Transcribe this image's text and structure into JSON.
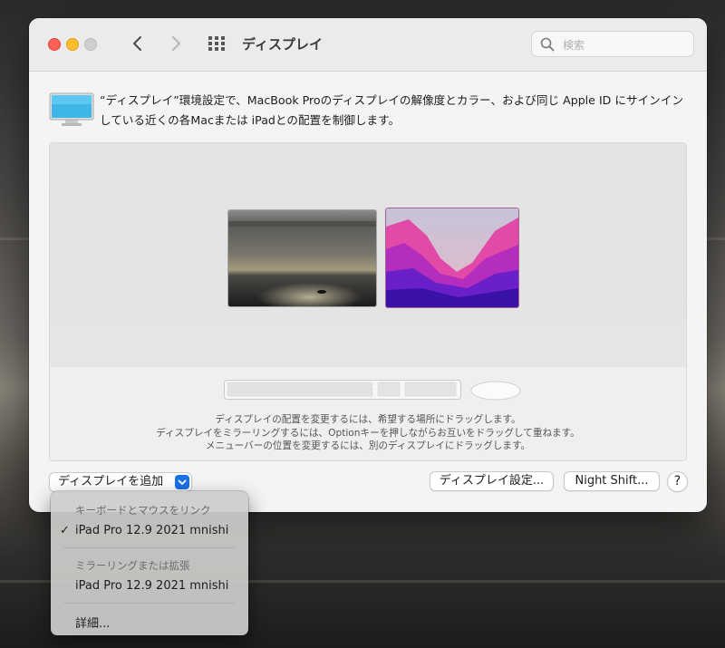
{
  "window": {
    "title": "ディスプレイ",
    "search_placeholder": "検索"
  },
  "description": "“ディスプレイ”環境設定で、MacBook Proのディスプレイの解像度とカラー、および同じ Apple ID にサインインしている近くの各Macまたは iPadとの配置を制御します。",
  "arrangement": {
    "hint_lines": [
      "ディスプレイの配置を変更するには、希望する場所にドラッグします。",
      "ディスプレイをミラーリングするには、Optionキーを押しながらお互いをドラッグして重ねます。",
      "メニューバーの位置を変更するには、別のディスプレイにドラッグします。"
    ]
  },
  "buttons": {
    "add_display": "ディスプレイを追加",
    "display_settings": "ディスプレイ設定...",
    "night_shift": "Night Shift...",
    "help": "?"
  },
  "menu": {
    "section1_header": "キーボードとマウスをリンク",
    "section1_item": "iPad Pro 12.9 2021 mnishi",
    "section1_checked": "✓",
    "section2_header": "ミラーリングまたは拡張",
    "section2_item": "iPad Pro 12.9 2021 mnishi",
    "more": "詳細..."
  },
  "colors": {
    "accent": "#1a72e8",
    "close": "#ff5f57",
    "minimize": "#febc2e"
  }
}
